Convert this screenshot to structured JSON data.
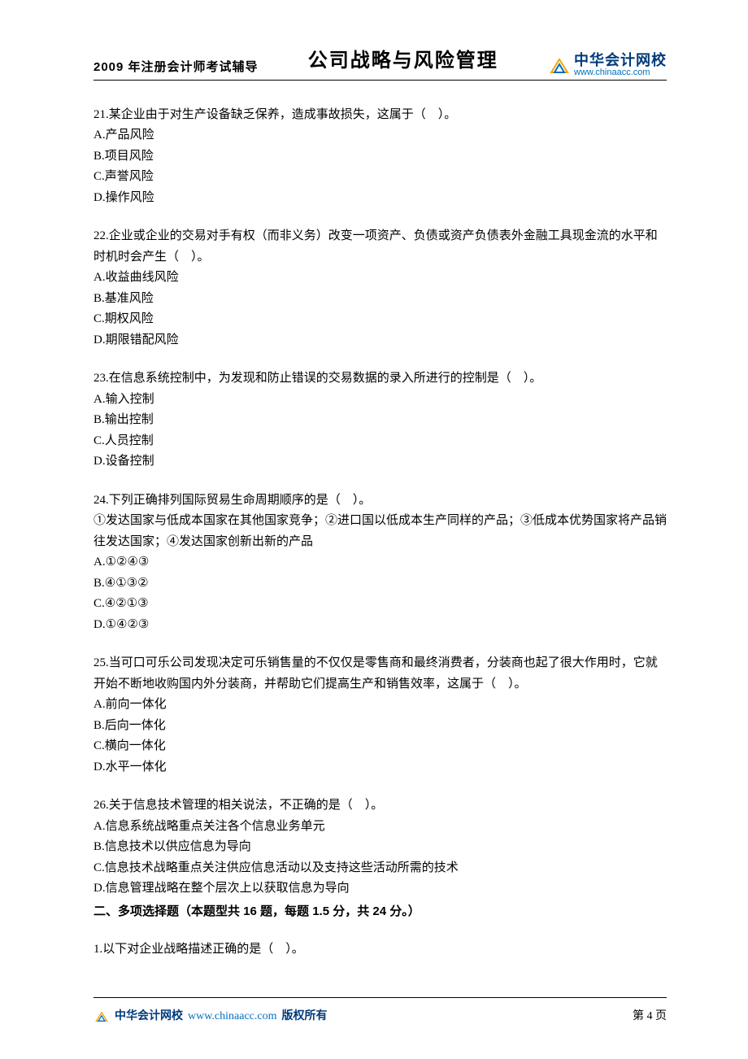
{
  "header": {
    "left": "2009 年注册会计师考试辅导",
    "center": "公司战略与风险管理",
    "logo_cn": "中华会计网校",
    "logo_url": "www.chinaacc.com"
  },
  "questions": [
    {
      "stem": "21.某企业由于对生产设备缺乏保养，造成事故损失，这属于（　）。",
      "options": [
        "A.产品风险",
        "B.项目风险",
        "C.声誉风险",
        "D.操作风险"
      ]
    },
    {
      "stem": "22.企业或企业的交易对手有权（而非义务）改变一项资产、负债或资产负债表外金融工具现金流的水平和时机时会产生（　）。",
      "options": [
        "A.收益曲线风险",
        "B.基准风险",
        "C.期权风险",
        "D.期限错配风险"
      ]
    },
    {
      "stem": "23.在信息系统控制中，为发现和防止错误的交易数据的录入所进行的控制是（　）。",
      "options": [
        "A.输入控制",
        "B.输出控制",
        "C.人员控制",
        "D.设备控制"
      ]
    },
    {
      "stem": "24.下列正确排列国际贸易生命周期顺序的是（　）。",
      "extra": [
        "①发达国家与低成本国家在其他国家竞争；②进口国以低成本生产同样的产品；③低成本优势国家将产品销往发达国家；④发达国家创新出新的产品"
      ],
      "options": [
        "A.①②④③",
        "B.④①③②",
        "C.④②①③",
        "D.①④②③"
      ]
    },
    {
      "stem": "25.当可口可乐公司发现决定可乐销售量的不仅仅是零售商和最终消费者，分装商也起了很大作用时，它就开始不断地收购国内外分装商，并帮助它们提高生产和销售效率，这属于（　）。",
      "options": [
        "A.前向一体化",
        "B.后向一体化",
        "C.横向一体化",
        "D.水平一体化"
      ]
    },
    {
      "stem": "26.关于信息技术管理的相关说法，不正确的是（　）。",
      "options": [
        "A.信息系统战略重点关注各个信息业务单元",
        "B.信息技术以供应信息为导向",
        "C.信息技术战略重点关注供应信息活动以及支持这些活动所需的技术",
        "D.信息管理战略在整个层次上以获取信息为导向"
      ]
    }
  ],
  "section2": "二、多项选择题（本题型共 16 题，每题 1.5 分，共 24 分。）",
  "section2_q1": "1.以下对企业战略描述正确的是（　）。",
  "footer": {
    "name": "中华会计网校",
    "url": "www.chinaacc.com",
    "rights": "版权所有",
    "page": "第 4 页"
  }
}
